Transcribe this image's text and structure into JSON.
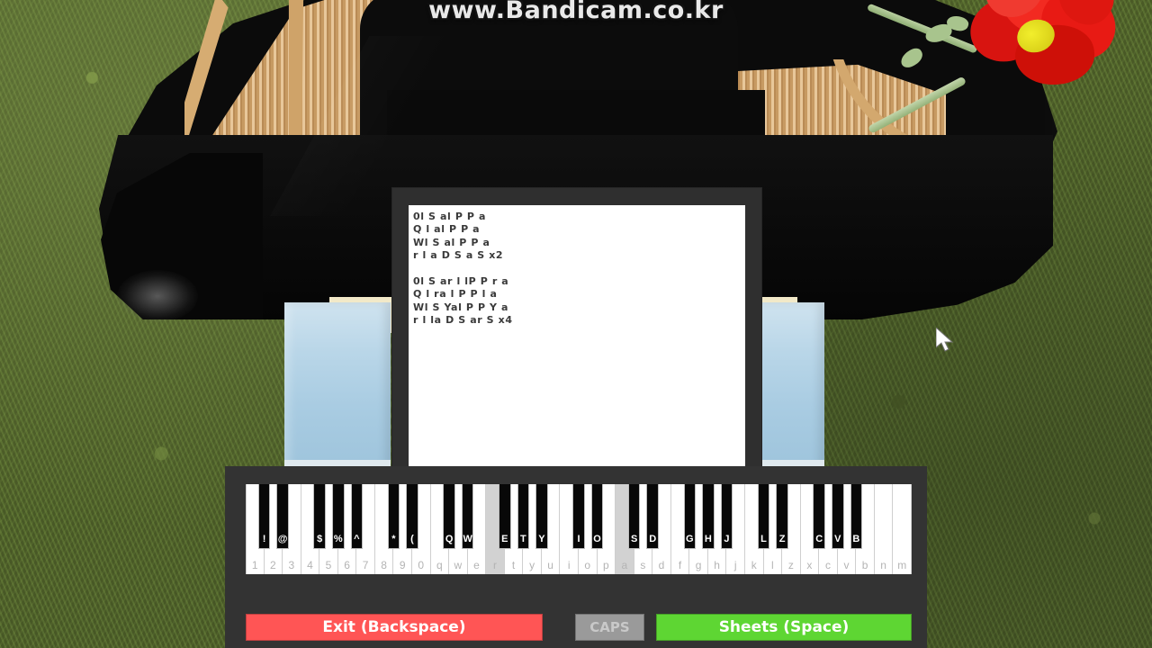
{
  "scene": {
    "watermark": "www.Bandicam.co.kr",
    "description": "Roblox virtual piano game with sheet-music overlay"
  },
  "sheets_panel": {
    "name": "sheet-music-viewer",
    "lines": [
      "0l S al P P a",
      "Q l al P P a",
      "Wl S al P P a",
      "r l a D S a S x2",
      "",
      "0l S ar l lP P r a",
      "Q l ra l P P l a",
      "Wl S Yal P P Y a",
      "r l la D S ar S x4"
    ]
  },
  "piano_ui": {
    "white_keys": [
      {
        "label": "1",
        "active": false
      },
      {
        "label": "2",
        "active": false
      },
      {
        "label": "3",
        "active": false
      },
      {
        "label": "4",
        "active": false
      },
      {
        "label": "5",
        "active": false
      },
      {
        "label": "6",
        "active": false
      },
      {
        "label": "7",
        "active": false
      },
      {
        "label": "8",
        "active": false
      },
      {
        "label": "9",
        "active": false
      },
      {
        "label": "0",
        "active": false
      },
      {
        "label": "q",
        "active": false
      },
      {
        "label": "w",
        "active": false
      },
      {
        "label": "e",
        "active": false
      },
      {
        "label": "r",
        "active": true
      },
      {
        "label": "t",
        "active": false
      },
      {
        "label": "y",
        "active": false
      },
      {
        "label": "u",
        "active": false
      },
      {
        "label": "i",
        "active": false
      },
      {
        "label": "o",
        "active": false
      },
      {
        "label": "p",
        "active": false
      },
      {
        "label": "a",
        "active": true
      },
      {
        "label": "s",
        "active": false
      },
      {
        "label": "d",
        "active": false
      },
      {
        "label": "f",
        "active": false
      },
      {
        "label": "g",
        "active": false
      },
      {
        "label": "h",
        "active": false
      },
      {
        "label": "j",
        "active": false
      },
      {
        "label": "k",
        "active": false
      },
      {
        "label": "l",
        "active": false
      },
      {
        "label": "z",
        "active": false
      },
      {
        "label": "x",
        "active": false
      },
      {
        "label": "c",
        "active": false
      },
      {
        "label": "v",
        "active": false
      },
      {
        "label": "b",
        "active": false
      },
      {
        "label": "n",
        "active": false
      },
      {
        "label": "m",
        "active": false
      }
    ],
    "black_keys": [
      {
        "label": "!",
        "after": 0
      },
      {
        "label": "@",
        "after": 1
      },
      {
        "label": "$",
        "after": 3
      },
      {
        "label": "%",
        "after": 4
      },
      {
        "label": "^",
        "after": 5
      },
      {
        "label": "*",
        "after": 7
      },
      {
        "label": "(",
        "after": 8
      },
      {
        "label": "Q",
        "after": 10
      },
      {
        "label": "W",
        "after": 11
      },
      {
        "label": "E",
        "after": 13
      },
      {
        "label": "T",
        "after": 14
      },
      {
        "label": "Y",
        "after": 15
      },
      {
        "label": "I",
        "after": 17
      },
      {
        "label": "O",
        "after": 18
      },
      {
        "label": "S",
        "after": 20
      },
      {
        "label": "D",
        "after": 21
      },
      {
        "label": "G",
        "after": 23
      },
      {
        "label": "H",
        "after": 24
      },
      {
        "label": "J",
        "after": 25
      },
      {
        "label": "L",
        "after": 27
      },
      {
        "label": "Z",
        "after": 28
      },
      {
        "label": "C",
        "after": 30
      },
      {
        "label": "V",
        "after": 31
      },
      {
        "label": "B",
        "after": 32
      }
    ],
    "buttons": {
      "exit": "Exit (Backspace)",
      "caps": "CAPS",
      "sheets": "Sheets (Space)"
    },
    "colors": {
      "exit": "#ff5555",
      "caps": "#9a9a9a",
      "sheets": "#5ed633",
      "panel": "#333333",
      "key_active": "#d2d2d2"
    }
  }
}
